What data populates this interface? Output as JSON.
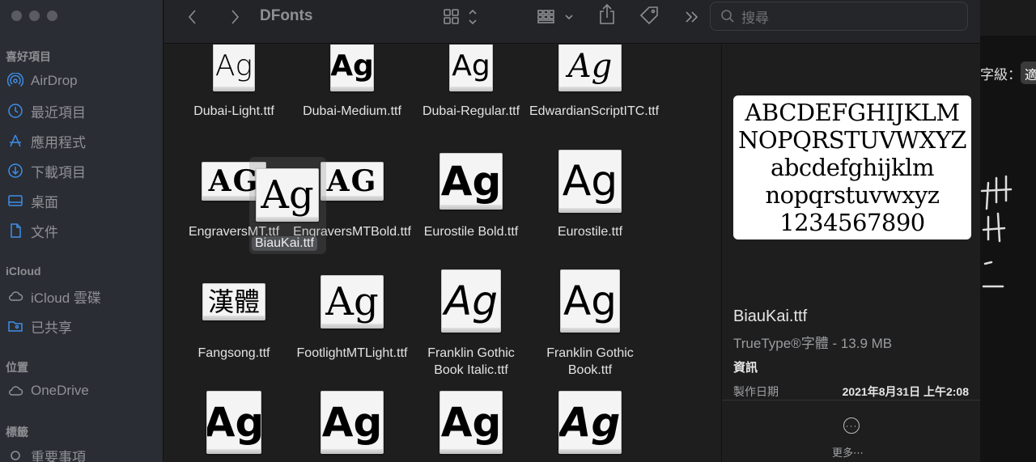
{
  "window": {
    "title": "DFonts"
  },
  "sidebar": {
    "sections": [
      {
        "label": "喜好項目",
        "items": [
          {
            "label": "AirDrop",
            "icon": "airdrop-icon"
          },
          {
            "label": "最近項目",
            "icon": "clock-icon"
          },
          {
            "label": "應用程式",
            "icon": "applications-icon"
          },
          {
            "label": "下載項目",
            "icon": "download-icon"
          },
          {
            "label": "桌面",
            "icon": "desktop-icon"
          },
          {
            "label": "文件",
            "icon": "document-icon"
          }
        ]
      },
      {
        "label": "iCloud",
        "items": [
          {
            "label": "iCloud 雲碟",
            "icon": "cloud-icon"
          },
          {
            "label": "已共享",
            "icon": "shared-folder-icon"
          }
        ]
      },
      {
        "label": "位置",
        "items": [
          {
            "label": "OneDrive",
            "icon": "cloud-icon"
          }
        ]
      },
      {
        "label": "標籤",
        "items": [
          {
            "label": "重要事項",
            "icon": "tag-circle-icon"
          }
        ]
      }
    ]
  },
  "toolbar": {
    "search_placeholder": "搜尋",
    "icons": [
      "back-icon",
      "forward-icon",
      "icon-view-icon",
      "group-icon",
      "share-icon",
      "tag-icon",
      "more-toolbar-icon",
      "search-icon"
    ]
  },
  "files": [
    {
      "name": "Dubai-Light.ttf",
      "glyph": "Ag"
    },
    {
      "name": "Dubai-Medium.ttf",
      "glyph": "Ag"
    },
    {
      "name": "Dubai-Regular.ttf",
      "glyph": "Ag"
    },
    {
      "name": "EdwardianScriptITC.ttf",
      "glyph": "Ag"
    },
    {
      "name": "EngraversMT.ttf",
      "glyph": "AG"
    },
    {
      "name": "EngraversMTBold.ttf",
      "glyph": "AG"
    },
    {
      "name": "Eurostile Bold.ttf",
      "glyph": "Ag"
    },
    {
      "name": "Eurostile.ttf",
      "glyph": "Ag"
    },
    {
      "name": "Fangsong.ttf",
      "glyph": "漢體"
    },
    {
      "name": "FootlightMTLight.ttf",
      "glyph": "Ag"
    },
    {
      "name": "Franklin Gothic Book Italic.ttf",
      "glyph": "Ag"
    },
    {
      "name": "Franklin Gothic Book.ttf",
      "glyph": "Ag"
    },
    {
      "name": "",
      "glyph": "Ag"
    },
    {
      "name": "",
      "glyph": "Ag"
    },
    {
      "name": "",
      "glyph": "Ag"
    },
    {
      "name": "",
      "glyph": "Ag"
    }
  ],
  "dragged": {
    "name": "BiauKai.ttf",
    "glyph": "Ag"
  },
  "preview": {
    "sample_lines": [
      "ABCDEFGHIJKLM",
      "NOPQRSTUVWXYZ",
      "abcdefghijklm",
      "nopqrstuvwxyz",
      "1234567890"
    ],
    "name": "BiauKai.ttf",
    "type": "TrueType®字體 - 13.9 MB",
    "info_heading": "資訊",
    "created_label": "製作日期",
    "created_value": "2021年8月31日 上午2:08",
    "more_label": "更多⋯"
  },
  "background_app": {
    "label": "字級：",
    "select_value": "適"
  }
}
